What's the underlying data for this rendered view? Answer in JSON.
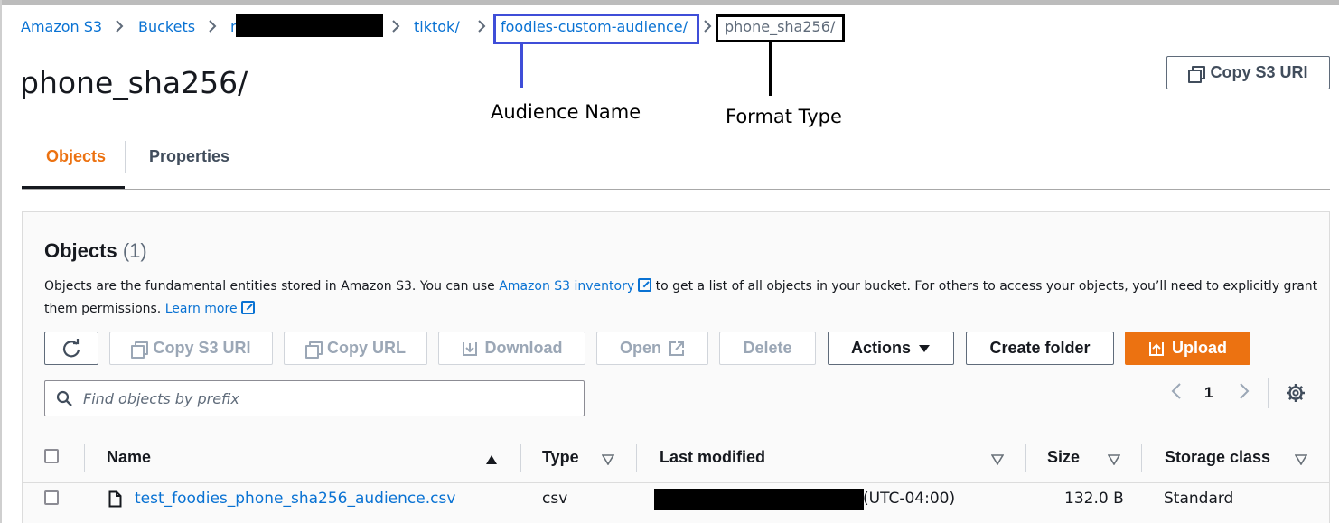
{
  "breadcrumb": {
    "items": [
      "Amazon S3",
      "Buckets",
      "n",
      "tiktok/",
      "foodies-custom-audience/",
      "phone_sha256/"
    ],
    "separator": ">"
  },
  "annotations": {
    "audience_name": "Audience Name",
    "format_type": "Format Type"
  },
  "header": {
    "title": "phone_sha256/",
    "copy_uri_label": "Copy S3 URI"
  },
  "tabs": [
    {
      "label": "Objects",
      "active": true
    },
    {
      "label": "Properties",
      "active": false
    }
  ],
  "objects_panel": {
    "title": "Objects",
    "count": "(1)",
    "desc_1": "Objects are the fundamental entities stored in Amazon S3. You can use",
    "desc_link_1": "Amazon S3 inventory",
    "desc_2": "to get a list of all objects in your bucket. For others to access your objects, you’ll need to explicitly grant",
    "desc_3": "them permissions.",
    "desc_link_2": "Learn more"
  },
  "toolbar": {
    "copy_s3_uri": "Copy S3 URI",
    "copy_url": "Copy URL",
    "download": "Download",
    "open": "Open",
    "delete": "Delete",
    "actions": "Actions",
    "create_folder": "Create folder",
    "upload": "Upload"
  },
  "search": {
    "placeholder": "Find objects by prefix",
    "value": ""
  },
  "pagination": {
    "current_page": "1"
  },
  "table": {
    "columns": [
      "Name",
      "Type",
      "Last modified",
      "Size",
      "Storage class"
    ],
    "rows": [
      {
        "name": "test_foodies_phone_sha256_audience.csv",
        "type": "csv",
        "last_modified_suffix": "(UTC-04:00)",
        "size": "132.0 B",
        "storage_class": "Standard"
      }
    ]
  },
  "colors": {
    "accent": "#ec7211",
    "link": "#0972d3",
    "annotation_box": "#3f4ed8"
  },
  "icons": [
    "chevron-right-icon",
    "copy-icon",
    "refresh-icon",
    "download-icon",
    "external-link-icon",
    "caret-down-icon",
    "upload-icon",
    "search-icon",
    "chevron-left-icon",
    "gear-icon",
    "sort-asc-icon",
    "sort-desc-icon",
    "file-icon"
  ]
}
